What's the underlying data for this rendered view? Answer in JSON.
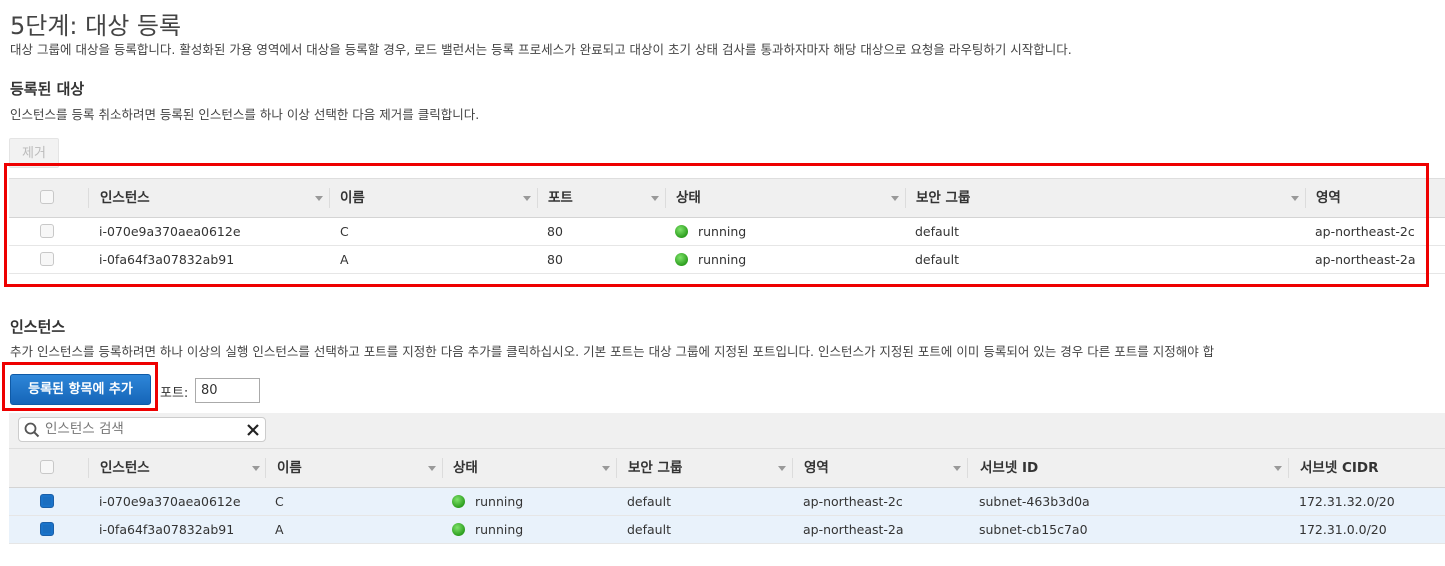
{
  "page": {
    "title": "5단계: 대상 등록",
    "description": "대상 그룹에 대상을 등록합니다. 활성화된 가용 영역에서 대상을 등록할 경우, 로드 밸런서는 등록 프로세스가 완료되고 대상이 초기 상태 검사를 통과하자마자 해당 대상으로 요청을 라우팅하기 시작합니다."
  },
  "registered": {
    "heading": "등록된 대상",
    "help": "인스턴스를 등록 취소하려면 등록된 인스턴스를 하나 이상 선택한 다음 제거를 클릭합니다.",
    "remove_label": "제거",
    "columns": [
      "인스턴스",
      "이름",
      "포트",
      "상태",
      "보안 그룹",
      "영역"
    ],
    "rows": [
      {
        "instance": "i-070e9a370aea0612e",
        "name": "C",
        "port": "80",
        "status": "running",
        "sg": "default",
        "zone": "ap-northeast-2c"
      },
      {
        "instance": "i-0fa64f3a07832ab91",
        "name": "A",
        "port": "80",
        "status": "running",
        "sg": "default",
        "zone": "ap-northeast-2a"
      }
    ]
  },
  "instances": {
    "heading": "인스턴스",
    "help": "추가 인스턴스를 등록하려면 하나 이상의 실행 인스턴스를 선택하고 포트를 지정한 다음 추가를 클릭하십시오. 기본 포트는 대상 그룹에 지정된 포트입니다. 인스턴스가 지정된 포트에 이미 등록되어 있는 경우 다른 포트를 지정해야 합",
    "add_label": "등록된 항목에 추가",
    "port_label": "포트:",
    "port_value": "80",
    "search_placeholder": "인스턴스 검색",
    "columns": [
      "인스턴스",
      "이름",
      "상태",
      "보안 그룹",
      "영역",
      "서브넷 ID",
      "서브넷 CIDR"
    ],
    "rows": [
      {
        "instance": "i-070e9a370aea0612e",
        "name": "C",
        "status": "running",
        "sg": "default",
        "zone": "ap-northeast-2c",
        "subnet": "subnet-463b3d0a",
        "cidr": "172.31.32.0/20",
        "checked": true
      },
      {
        "instance": "i-0fa64f3a07832ab91",
        "name": "A",
        "status": "running",
        "sg": "default",
        "zone": "ap-northeast-2a",
        "subnet": "subnet-cb15c7a0",
        "cidr": "172.31.0.0/20",
        "checked": true
      }
    ]
  },
  "colors": {
    "highlight": "#e00000",
    "primary_button": "#1a6ec0",
    "status_running": "#2d9e1f",
    "selected_row": "#e9f2fb"
  }
}
